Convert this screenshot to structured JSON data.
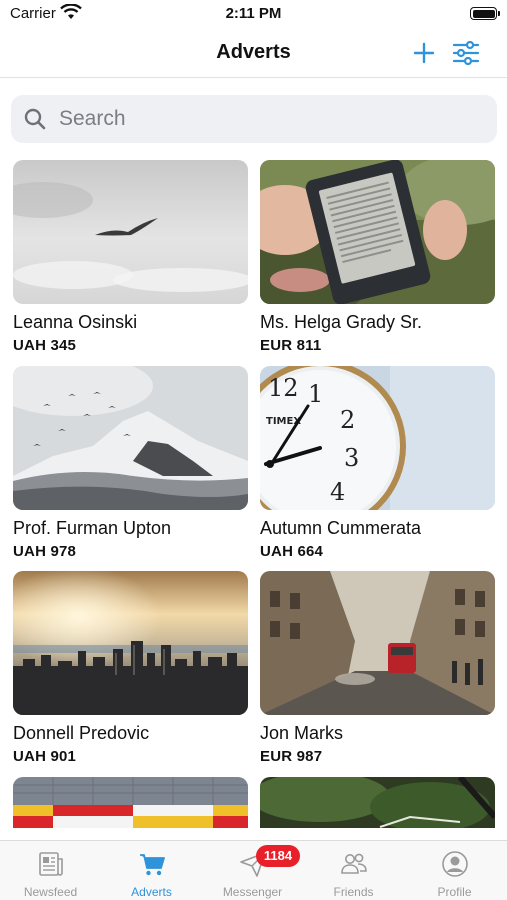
{
  "status_bar": {
    "carrier": "Carrier",
    "time": "2:11 PM"
  },
  "nav": {
    "title": "Adverts"
  },
  "search": {
    "placeholder": "Search",
    "value": ""
  },
  "adverts": [
    {
      "name": "Leanna Osinski",
      "price": "UAH 345",
      "image": "seagull-sky"
    },
    {
      "name": "Ms. Helga Grady Sr.",
      "price": "EUR 811",
      "image": "e-reader-on-grass"
    },
    {
      "name": "Prof. Furman Upton",
      "price": "UAH 978",
      "image": "snowy-mountain-birds"
    },
    {
      "name": "Autumn Cummerata",
      "price": "UAH 664",
      "image": "timex-clock"
    },
    {
      "name": "Donnell Predovic",
      "price": "UAH 901",
      "image": "city-sunset-skyline"
    },
    {
      "name": "Jon Marks",
      "price": "EUR 987",
      "image": "london-street-bus"
    },
    {
      "name": "",
      "price": "",
      "image": "striped-building"
    },
    {
      "name": "",
      "price": "",
      "image": "forest-bike"
    }
  ],
  "tabs": [
    {
      "label": "Newsfeed",
      "icon": "newspaper-icon",
      "active": false
    },
    {
      "label": "Adverts",
      "icon": "cart-icon",
      "active": true
    },
    {
      "label": "Messenger",
      "icon": "paper-plane-icon",
      "active": false,
      "badge": "1184"
    },
    {
      "label": "Friends",
      "icon": "people-icon",
      "active": false
    },
    {
      "label": "Profile",
      "icon": "person-circle-icon",
      "active": false
    }
  ],
  "colors": {
    "accent": "#2f93d9",
    "badge": "#e8202a",
    "search_bg": "#eff0f3",
    "inactive_tab": "#9a9a9a"
  }
}
